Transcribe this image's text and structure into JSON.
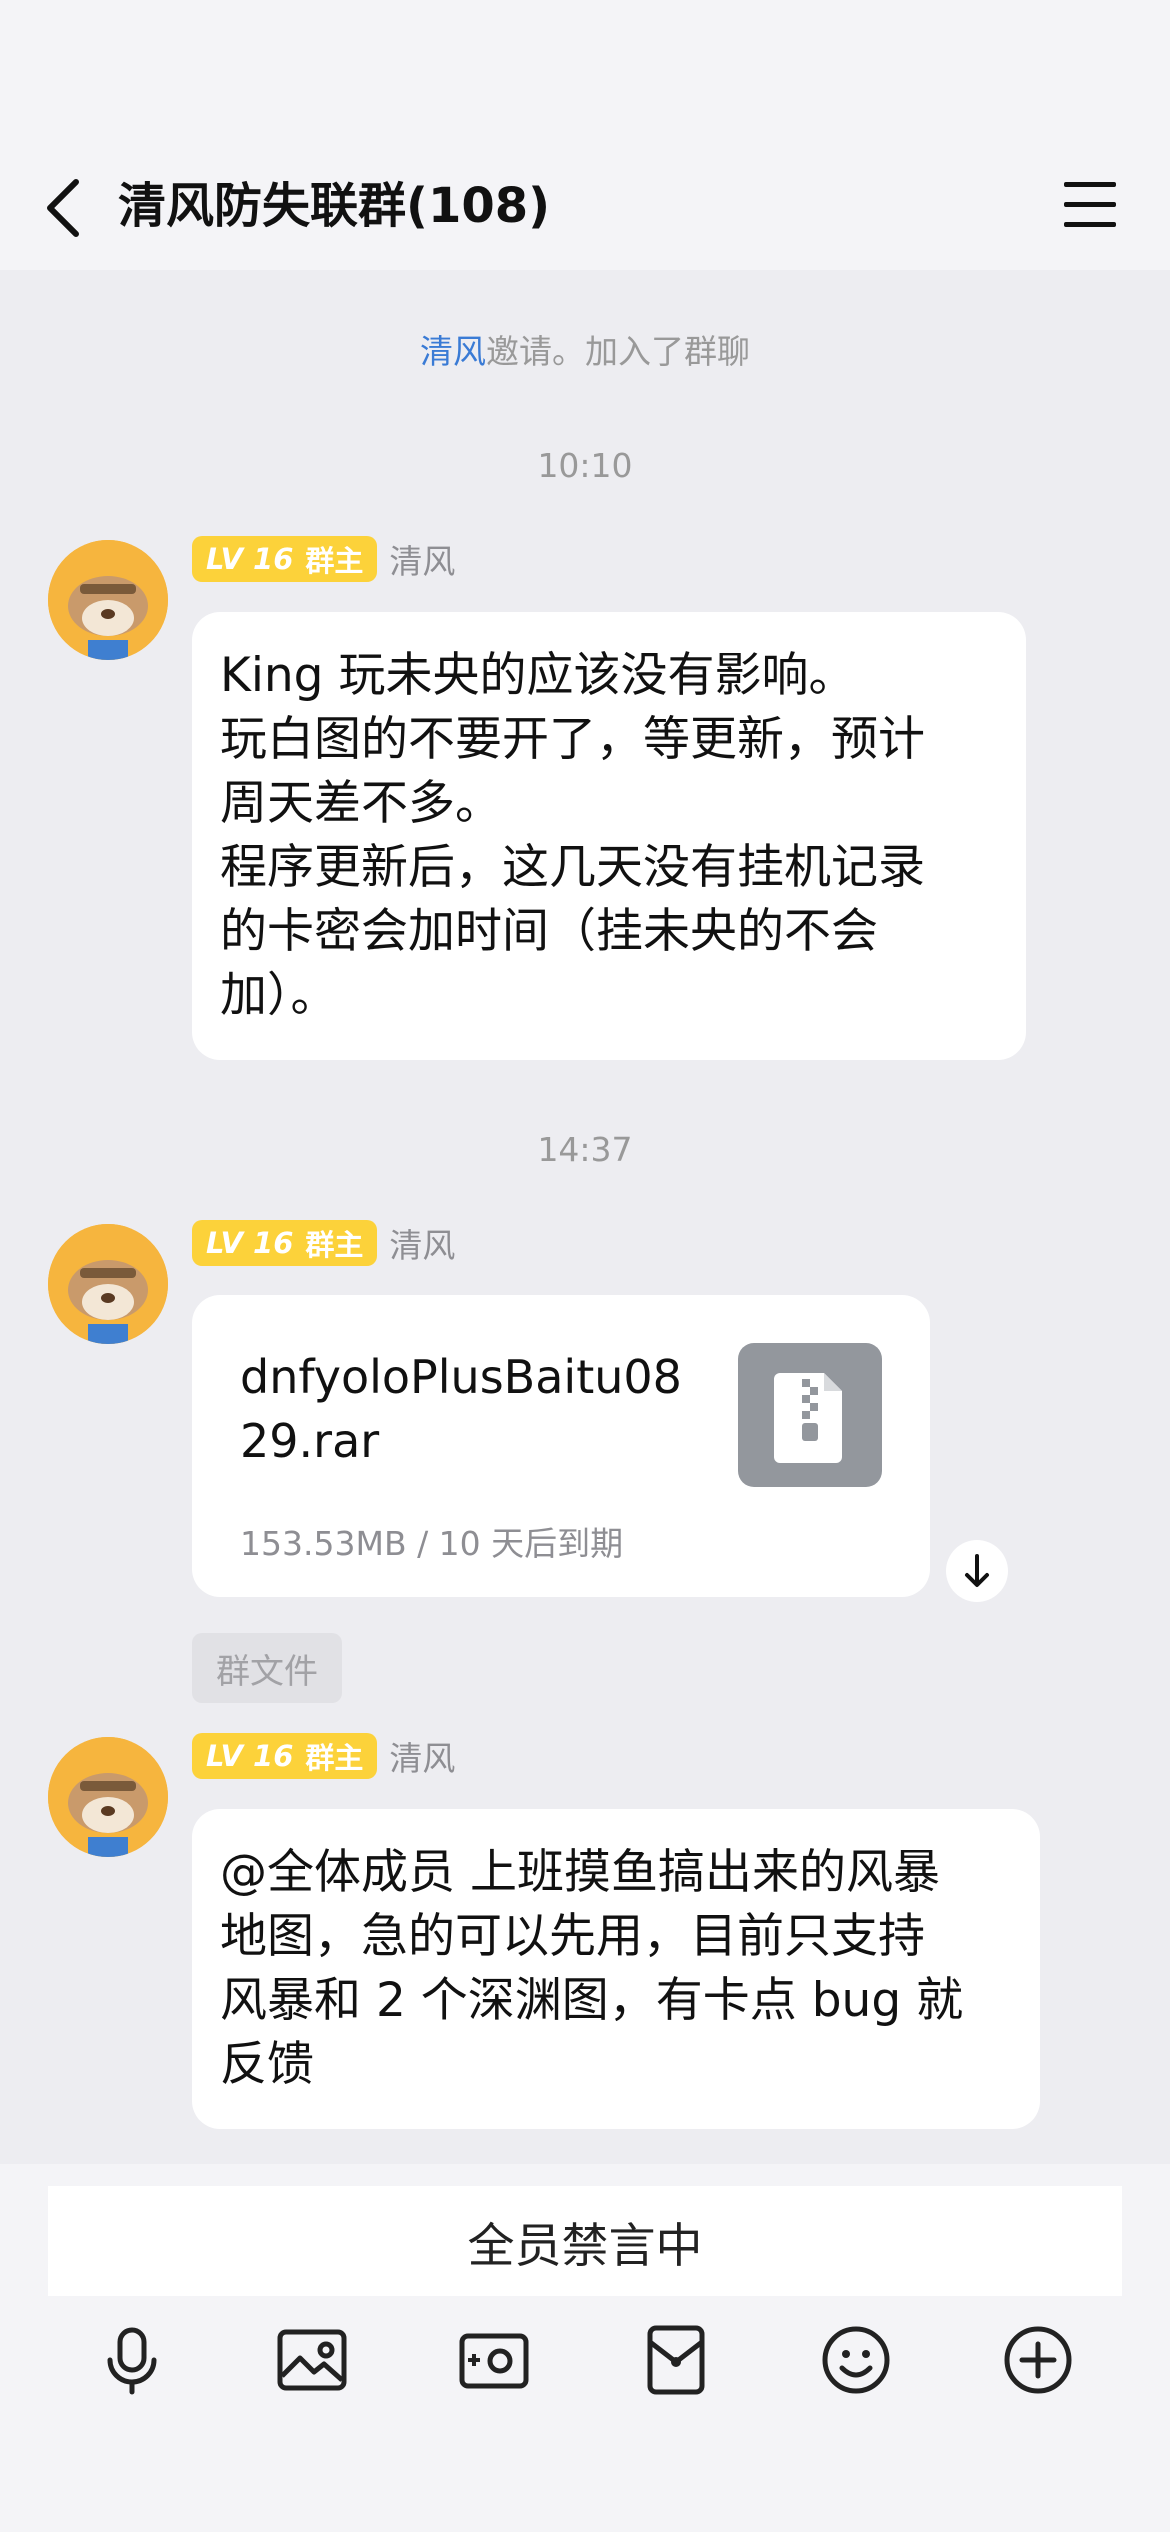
{
  "header": {
    "title": "清风防失联群(108)"
  },
  "system": {
    "invite_name": "清风",
    "invite_text": "邀请。加入了群聊"
  },
  "messages": [
    {
      "time": "10:10",
      "badge_level": "LV 16",
      "badge_role": "群主",
      "sender": "清风",
      "text": "King 玩未央的应该没有影响。\n玩白图的不要开了，等更新，预计\n周天差不多。\n程序更新后，这几天没有挂机记录\n的卡密会加时间（挂未央的不会\n加）。"
    },
    {
      "time": "14:37",
      "badge_level": "LV 16",
      "badge_role": "群主",
      "sender": "清风",
      "file_name": "dnfyoloPlusBaitu0829.rar",
      "file_meta": "153.53MB / 10 天后到期",
      "file_tag": "群文件"
    },
    {
      "badge_level": "LV 16",
      "badge_role": "群主",
      "sender": "清风",
      "text": "@全体成员 上班摸鱼搞出来的风暴\n地图，急的可以先用，目前只支持\n风暴和 2 个深渊图，有卡点 bug 就\n反馈"
    }
  ],
  "input": {
    "muted_text": "全员禁言中"
  },
  "icons": {
    "back": "chevron-left-icon",
    "menu": "menu-icon",
    "toolbar": [
      "microphone-icon",
      "image-icon",
      "camera-icon",
      "red-packet-icon",
      "emoji-icon",
      "plus-circle-icon"
    ]
  },
  "colors": {
    "badge": "#fcd23a",
    "link": "#3a7bd5",
    "background": "#ededf1"
  }
}
